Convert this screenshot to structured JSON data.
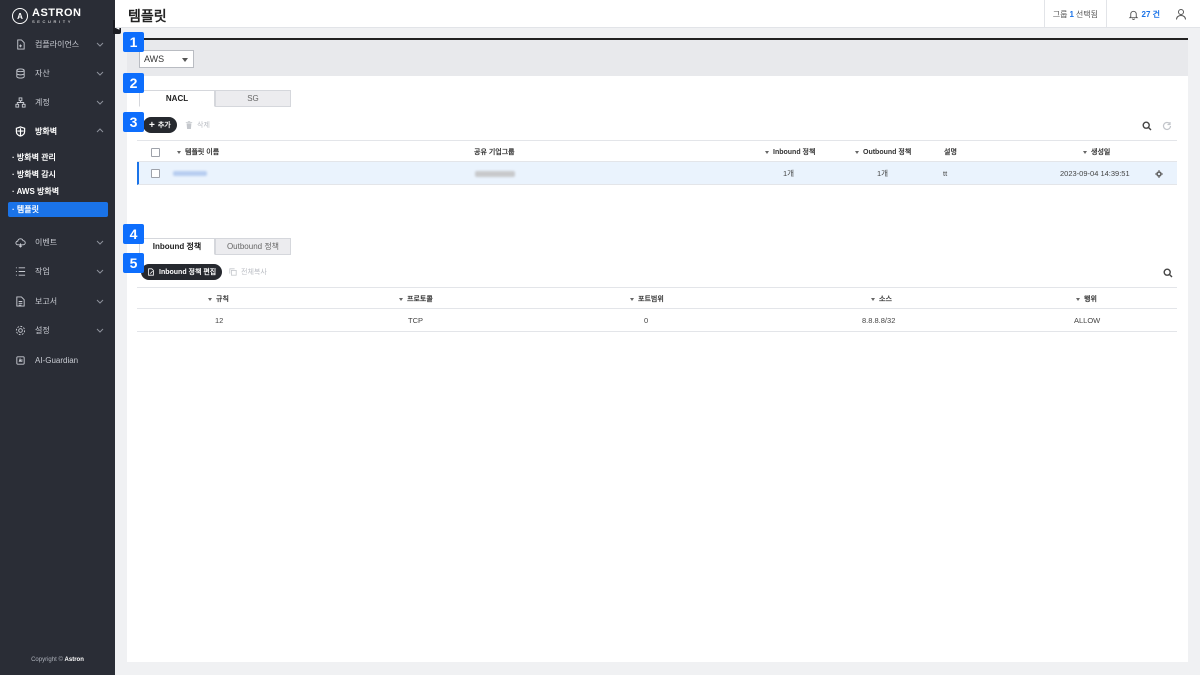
{
  "brand": {
    "name": "ASTRON",
    "sub": "SECURITY",
    "mark": "A"
  },
  "sidebar": {
    "items": [
      {
        "label": "컴플라이언스",
        "icon": "compliance-icon"
      },
      {
        "label": "자산",
        "icon": "database-icon"
      },
      {
        "label": "계정",
        "icon": "account-tree-icon"
      },
      {
        "label": "방화벽",
        "icon": "shield-icon"
      },
      {
        "label": "이벤트",
        "icon": "event-cloud-icon"
      },
      {
        "label": "작업",
        "icon": "task-list-icon"
      },
      {
        "label": "보고서",
        "icon": "report-icon"
      },
      {
        "label": "설정",
        "icon": "gear-icon"
      },
      {
        "label": "AI-Guardian",
        "icon": "ai-chip-icon"
      }
    ],
    "firewall_sub": [
      "· 방화벽 관리",
      "· 방화벽 감시",
      "· AWS 방화벽",
      "· 템플릿"
    ],
    "copyright_prefix": "Copyright ©",
    "copyright_brand": "Astron"
  },
  "header": {
    "title": "템플릿",
    "group_prefix": "그룹",
    "group_count": "1",
    "group_suffix": "선택됨",
    "notif_count": "27 건"
  },
  "filter": {
    "provider": "AWS"
  },
  "badges": [
    "1",
    "2",
    "3",
    "4",
    "5"
  ],
  "template_tabs": [
    "NACL",
    "SG"
  ],
  "template_toolbar": {
    "add_label": "추가",
    "delete_label": "삭제"
  },
  "template_table": {
    "headers": [
      "템플릿 이름",
      "공유 기업그룹",
      "Inbound 정책",
      "Outbound 정책",
      "설명",
      "생성일"
    ],
    "rows": [
      {
        "inbound": "1개",
        "outbound": "1개",
        "desc": "tt",
        "created": "2023-09-04 14:39:51"
      }
    ]
  },
  "policy_tabs": [
    "Inbound 정책",
    "Outbound 정책"
  ],
  "policy_toolbar": {
    "edit_label": "Inbound 정책 편집",
    "copy_label": "전체복사"
  },
  "policy_table": {
    "headers": [
      "규칙",
      "프로토콜",
      "포트범위",
      "소스",
      "행위"
    ],
    "rows": [
      {
        "rule": "12",
        "protocol": "TCP",
        "port": "0",
        "source": "8.8.8.8/32",
        "action": "ALLOW"
      }
    ]
  },
  "colors": {
    "accent": "#1a73e8",
    "sidebar_bg": "#2a2d36",
    "badge": "#0d6efd"
  }
}
